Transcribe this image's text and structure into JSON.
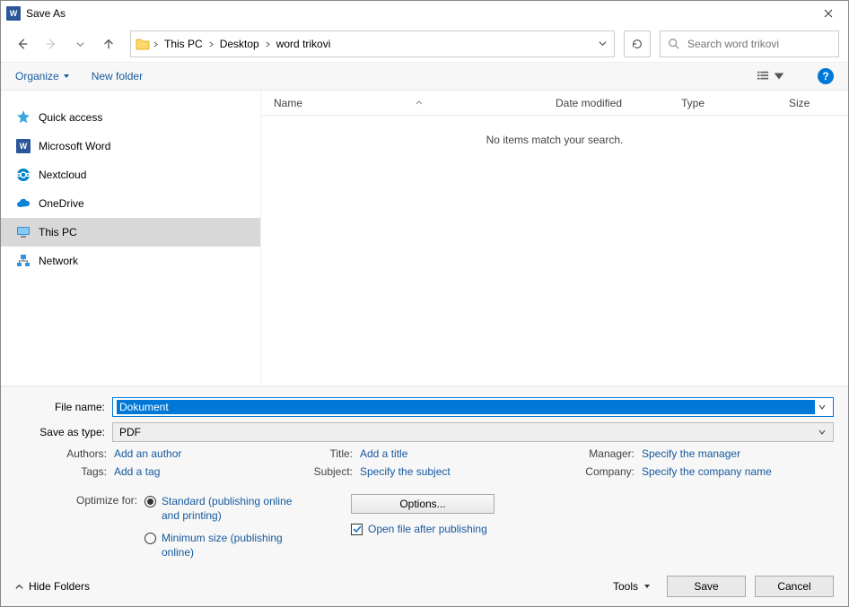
{
  "title": "Save As",
  "breadcrumbs": [
    "This PC",
    "Desktop",
    "word trikovi"
  ],
  "search": {
    "placeholder": "Search word trikovi"
  },
  "toolbar": {
    "organize": "Organize",
    "new_folder": "New folder"
  },
  "sidebar": {
    "items": [
      {
        "label": "Quick access"
      },
      {
        "label": "Microsoft Word"
      },
      {
        "label": "Nextcloud"
      },
      {
        "label": "OneDrive"
      },
      {
        "label": "This PC"
      },
      {
        "label": "Network"
      }
    ]
  },
  "columns": {
    "name": "Name",
    "date": "Date modified",
    "type": "Type",
    "size": "Size"
  },
  "empty_message": "No items match your search.",
  "fields": {
    "filename_label": "File name:",
    "filename_value": "Dokument",
    "type_label": "Save as type:",
    "type_value": "PDF"
  },
  "meta": {
    "authors_label": "Authors:",
    "authors_value": "Add an author",
    "tags_label": "Tags:",
    "tags_value": "Add a tag",
    "title_label": "Title:",
    "title_value": "Add a title",
    "subject_label": "Subject:",
    "subject_value": "Specify the subject",
    "manager_label": "Manager:",
    "manager_value": "Specify the manager",
    "company_label": "Company:",
    "company_value": "Specify the company name"
  },
  "optimize": {
    "label": "Optimize for:",
    "standard": "Standard (publishing online and printing)",
    "minimum": "Minimum size (publishing online)"
  },
  "options_button": "Options...",
  "open_after": "Open file after publishing",
  "footer": {
    "hide_folders": "Hide Folders",
    "tools": "Tools",
    "save": "Save",
    "cancel": "Cancel"
  }
}
